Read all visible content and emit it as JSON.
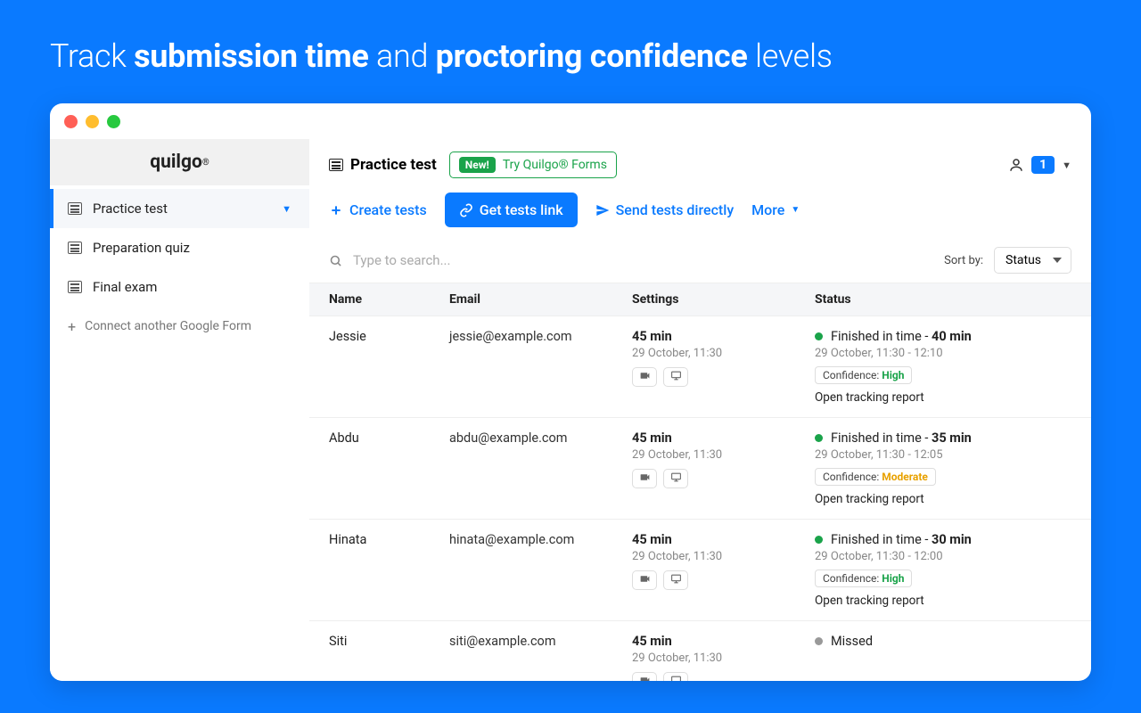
{
  "hero": {
    "prefix": "Track ",
    "b1": "submission time",
    "mid": " and ",
    "b2": "proctoring confidence",
    "suffix": " levels"
  },
  "brand": "quilgo",
  "sidebar": {
    "items": [
      {
        "label": "Practice test",
        "active": true
      },
      {
        "label": "Preparation quiz",
        "active": false
      },
      {
        "label": "Final exam",
        "active": false
      }
    ],
    "connect": "Connect another Google Form"
  },
  "header": {
    "title": "Practice test",
    "try_new": "New!",
    "try_label": "Try Quilgo® Forms",
    "badge": "1"
  },
  "actions": {
    "create": "Create tests",
    "getlink": "Get tests link",
    "send": "Send tests directly",
    "more": "More"
  },
  "search": {
    "placeholder": "Type to search..."
  },
  "sort": {
    "label": "Sort by:",
    "value": "Status"
  },
  "columns": {
    "name": "Name",
    "email": "Email",
    "settings": "Settings",
    "status": "Status"
  },
  "rows": [
    {
      "name": "Jessie",
      "email": "jessie@example.com",
      "duration": "45 min",
      "when": "29 October, 11:30",
      "status_type": "finished",
      "status_prefix": "Finished in time - ",
      "status_bold": "40 min",
      "status_time": "29 October, 11:30 - 12:10",
      "conf_label": "Confidence: ",
      "conf_value": "High",
      "conf_class": "hv",
      "tracking": "Open tracking report"
    },
    {
      "name": "Abdu",
      "email": "abdu@example.com",
      "duration": "45 min",
      "when": "29 October, 11:30",
      "status_type": "finished",
      "status_prefix": "Finished in time - ",
      "status_bold": "35 min",
      "status_time": "29 October, 11:30 - 12:05",
      "conf_label": "Confidence: ",
      "conf_value": "Moderate",
      "conf_class": "mv",
      "tracking": "Open tracking report"
    },
    {
      "name": "Hinata",
      "email": "hinata@example.com",
      "duration": "45 min",
      "when": "29 October, 11:30",
      "status_type": "finished",
      "status_prefix": "Finished in time - ",
      "status_bold": "30 min",
      "status_time": "29 October, 11:30 - 12:00",
      "conf_label": "Confidence: ",
      "conf_value": "High",
      "conf_class": "hv",
      "tracking": "Open tracking report"
    },
    {
      "name": "Siti",
      "email": "siti@example.com",
      "duration": "45 min",
      "when": "29 October, 11:30",
      "status_type": "missed",
      "status_prefix": "Missed",
      "status_bold": "",
      "status_time": "",
      "conf_label": "",
      "conf_value": "",
      "conf_class": "",
      "tracking": ""
    }
  ]
}
